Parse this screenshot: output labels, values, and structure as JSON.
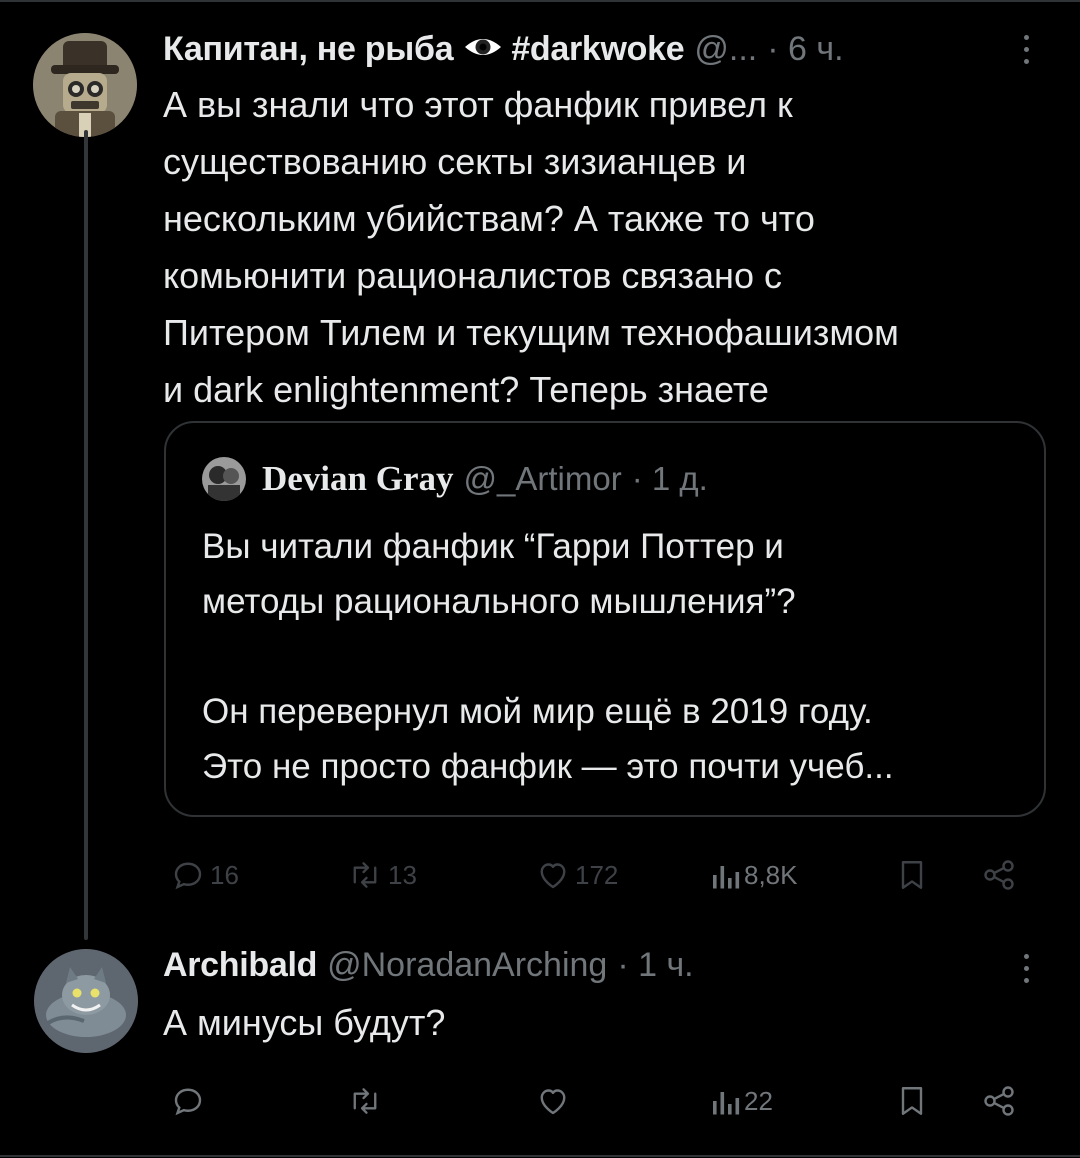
{
  "post": {
    "author_name": "Капитан, не рыба",
    "author_hashtag": "#darkwoke",
    "handle": "@...",
    "time": "· 6 ч.",
    "text": "А вы знали что этот фанфик привел к\nсуществованию секты зизианцев и\nнескольким убийствам? А также то что\nкомьюнити рационалистов связано с\nПитером Тилем и текущим технофашизмом\nи dark enlightenment? Теперь знаете",
    "quote": {
      "author_name": "Devian Gray",
      "handle": "@_Artimor",
      "time": "· 1 д.",
      "text": "Вы читали фанфик “Гарри Поттер и\nметоды рационального мышления”?\n\nОн перевернул мой мир ещё в 2019 году.\nЭто не просто фанфик — это почти учеб..."
    },
    "actions": {
      "replies": "16",
      "reposts": "13",
      "likes": "172",
      "views": "8,8K"
    }
  },
  "reply": {
    "author_name": "Archibald",
    "handle": "@NoradanArching",
    "time": "· 1 ч.",
    "text": "А минусы будут?",
    "actions": {
      "replies": "",
      "reposts": "",
      "likes": "",
      "views": "22"
    }
  },
  "colors": {
    "background": "#000000",
    "text": "#e7e9ea",
    "secondary": "#71767b",
    "border": "#2f3336"
  }
}
